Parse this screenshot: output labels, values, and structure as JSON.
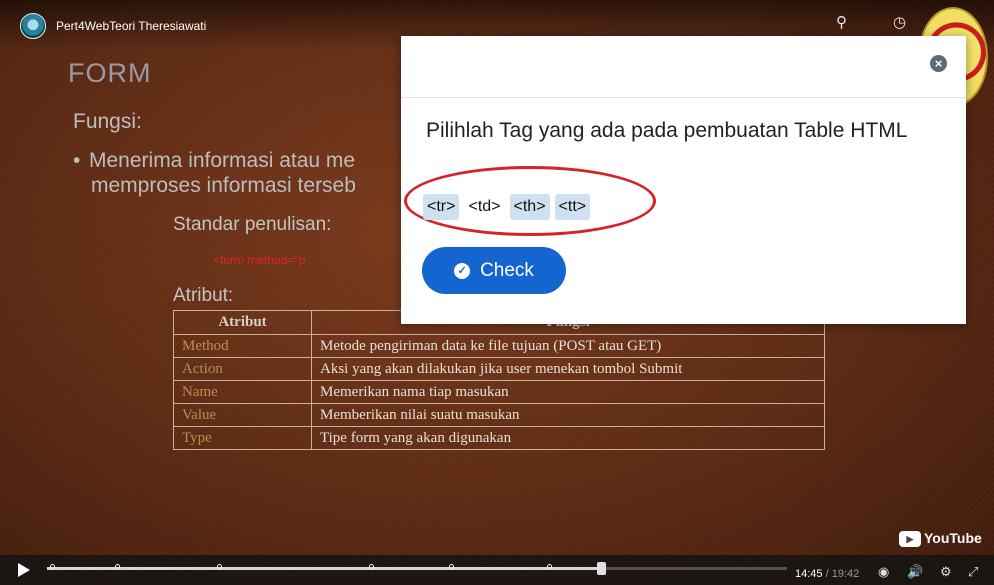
{
  "video": {
    "channel_title": "Pert4WebTeori Theresiawati",
    "search_icon": "search-icon",
    "clock_icon": "clock-icon",
    "share_icon": "share-icon"
  },
  "slide": {
    "heading": "FORM",
    "subheading": "Fungsi:",
    "bullet_visible": "Menerima informasi atau me",
    "bullet_line2": "memproses informasi terseb",
    "standard_label": "Standar penulisan:",
    "code_text": "<form method=\"p",
    "attribute_label": "Atribut:",
    "table": {
      "headers": [
        "Atribut",
        "Fungsi"
      ],
      "rows": [
        [
          "Method",
          "Metode pengiriman data ke file tujuan (POST atau GET)"
        ],
        [
          "Action",
          "Aksi yang akan dilakukan jika user menekan tombol Submit"
        ],
        [
          "Name",
          "Memerikan nama tiap masukan"
        ],
        [
          "Value",
          "Memberikan nilai suatu masukan"
        ],
        [
          "Type",
          "Tipe form yang akan digunakan"
        ]
      ]
    }
  },
  "quiz": {
    "question": "Pilihlah Tag yang ada pada pembuatan Table HTML",
    "options": [
      {
        "label": "<tr>",
        "selected": true
      },
      {
        "label": "<td>",
        "selected": false
      },
      {
        "label": "<th>",
        "selected": true
      },
      {
        "label": "<tt>",
        "selected": true
      }
    ],
    "check_label": "Check"
  },
  "player": {
    "current_time": "14:45",
    "separator": " / ",
    "duration": "19:42",
    "progress_fraction": 0.749,
    "youtube_label": "YouTube"
  },
  "colors": {
    "check_button": "#1565d0",
    "selected_chip": "#cfe0f1",
    "annotation_ring": "#d6222a"
  }
}
